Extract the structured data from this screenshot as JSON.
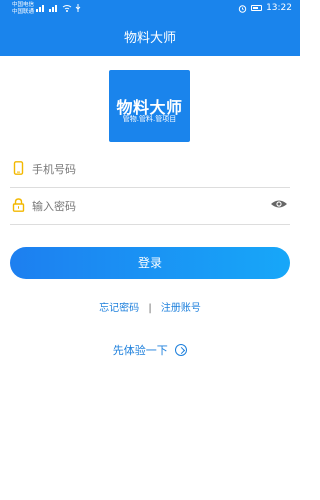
{
  "status_bar": {
    "carrier_1": "中国电信",
    "carrier_2": "中国联通",
    "time": "13:22"
  },
  "header": {
    "title": "物料大师"
  },
  "logo": {
    "main_text": "物料大师",
    "sub_text": "管物.管料.管项目"
  },
  "form": {
    "phone_placeholder": "手机号码",
    "password_placeholder": "输入密码"
  },
  "actions": {
    "login_label": "登录",
    "forgot_password": "忘记密码",
    "separator": "|",
    "register": "注册账号",
    "try_first": "先体验一下"
  },
  "icons": {
    "phone": "phone-icon",
    "lock": "lock-icon",
    "eye": "eye-icon",
    "arrow": "chevron-right-circle-icon"
  },
  "colors": {
    "brand": "#1a84ec",
    "link": "#1c7fdc",
    "icon_yellow": "#f3b800"
  }
}
